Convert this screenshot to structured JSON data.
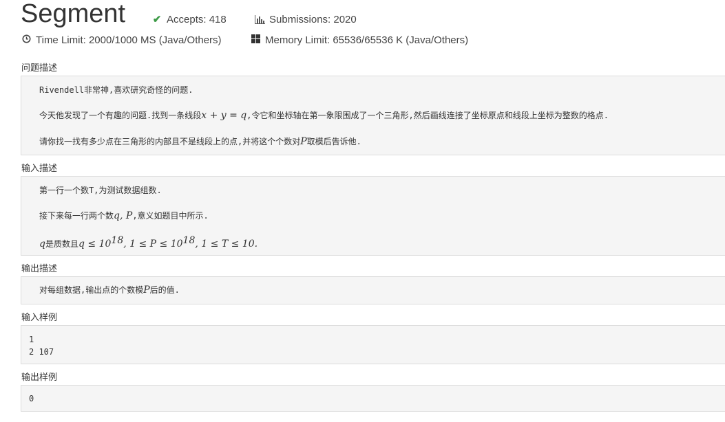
{
  "problem": {
    "title": "Segment",
    "accepts": "Accepts: 418",
    "submissions": "Submissions: 2020",
    "time_limit": "Time Limit: 2000/1000 MS (Java/Others)",
    "memory_limit": "Memory Limit: 65536/65536 K (Java/Others)"
  },
  "icons": {
    "accepts": "check-icon",
    "submissions": "bar-chart-icon",
    "time": "clock-icon",
    "memory": "grid-icon"
  },
  "sections": {
    "description": {
      "label": "问题描述",
      "line1": "Rivendell非常神,喜欢研究奇怪的问题.",
      "line2_a": "今天他发现了一个有趣的问题.找到一条线段",
      "line2_math": "x + y = q",
      "line2_b": ",令它和坐标轴在第一象限围成了一个三角形,然后画线连接了坐标原点和线段上坐标为整数的格点.",
      "line3_a": "请你找一找有多少点在三角形的内部且不是线段上的点,并将这个个数对",
      "line3_math": "P",
      "line3_b": "取模后告诉他."
    },
    "input": {
      "label": "输入描述",
      "line1": "第一行一个数T,为测试数据组数.",
      "line2_a": "接下来每一行两个数",
      "line2_math": "q, P",
      "line2_b": ",意义如题目中所示.",
      "line3_q": "q",
      "line3_text": "是质数且",
      "line3_m1": "q ≤ 10",
      "line3_e1": "18",
      "line3_m2": ", 1 ≤ P ≤ 10",
      "line3_e2": "18",
      "line3_m3": ", 1 ≤ T ≤ 10."
    },
    "output": {
      "label": "输出描述",
      "line1_a": "对每组数据,输出点的个数模",
      "line1_math": "P",
      "line1_b": "后的值."
    },
    "sample_input": {
      "label": "输入样例",
      "lines": [
        "1",
        "2 107"
      ]
    },
    "sample_output": {
      "label": "输出样例",
      "lines": [
        "0"
      ]
    }
  }
}
